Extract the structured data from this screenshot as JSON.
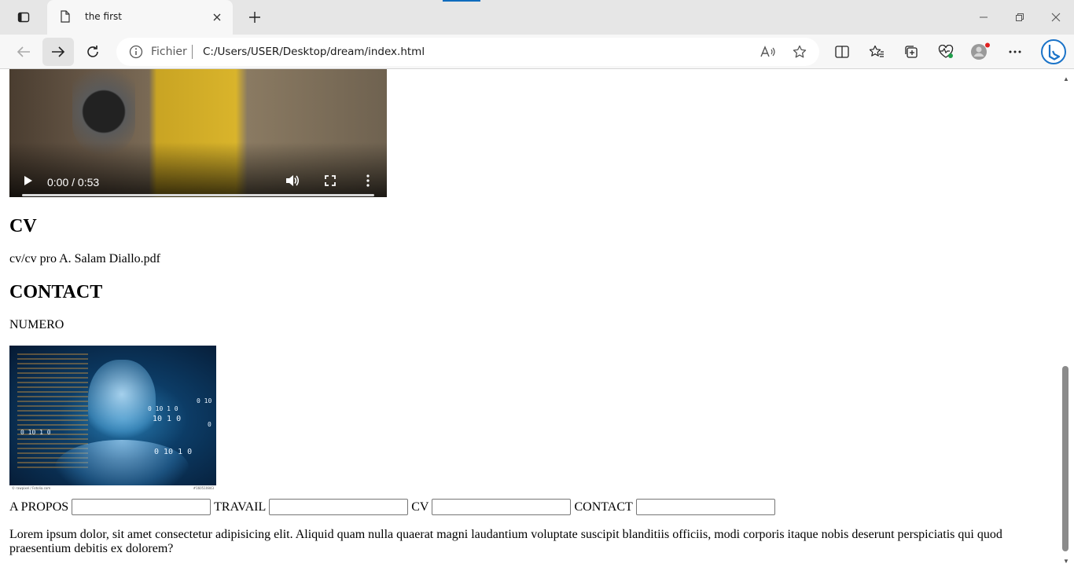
{
  "browser": {
    "tab": {
      "title": "the first"
    },
    "address": {
      "scheme_label": "Fichier",
      "url": "C:/Users/USER/Desktop/dream/index.html"
    }
  },
  "video": {
    "time": "0:00 / 0:53"
  },
  "sections": {
    "cv_heading": "CV",
    "cv_link": "cv/cv pro A. Salam Diallo.pdf",
    "contact_heading": "CONTACT",
    "numero": "NUMERO"
  },
  "image": {
    "digit_lines": [
      "0 10",
      "0  10 1 0",
      "10 1 0",
      "0",
      "0 10 1 0",
      "0  10 1 0"
    ],
    "footer_left": "© rawpixel / Fotolia.com",
    "footer_right": "#160510843"
  },
  "form": {
    "about_label": "A PROPOS",
    "work_label": "TRAVAIL",
    "cv_label": "CV",
    "contact_label": "CONTACT"
  },
  "lorem": "Lorem ipsum dolor, sit amet consectetur adipisicing elit. Aliquid quam nulla quaerat magni laudantium voluptate suscipit blanditiis officiis, modi corporis itaque nobis deserunt perspiciatis qui quod praesentium debitis ex dolorem?",
  "colors": {
    "accent": "#0f6cbd",
    "tabstrip": "#e6e6e6",
    "toolbar": "#f7f7f7"
  }
}
